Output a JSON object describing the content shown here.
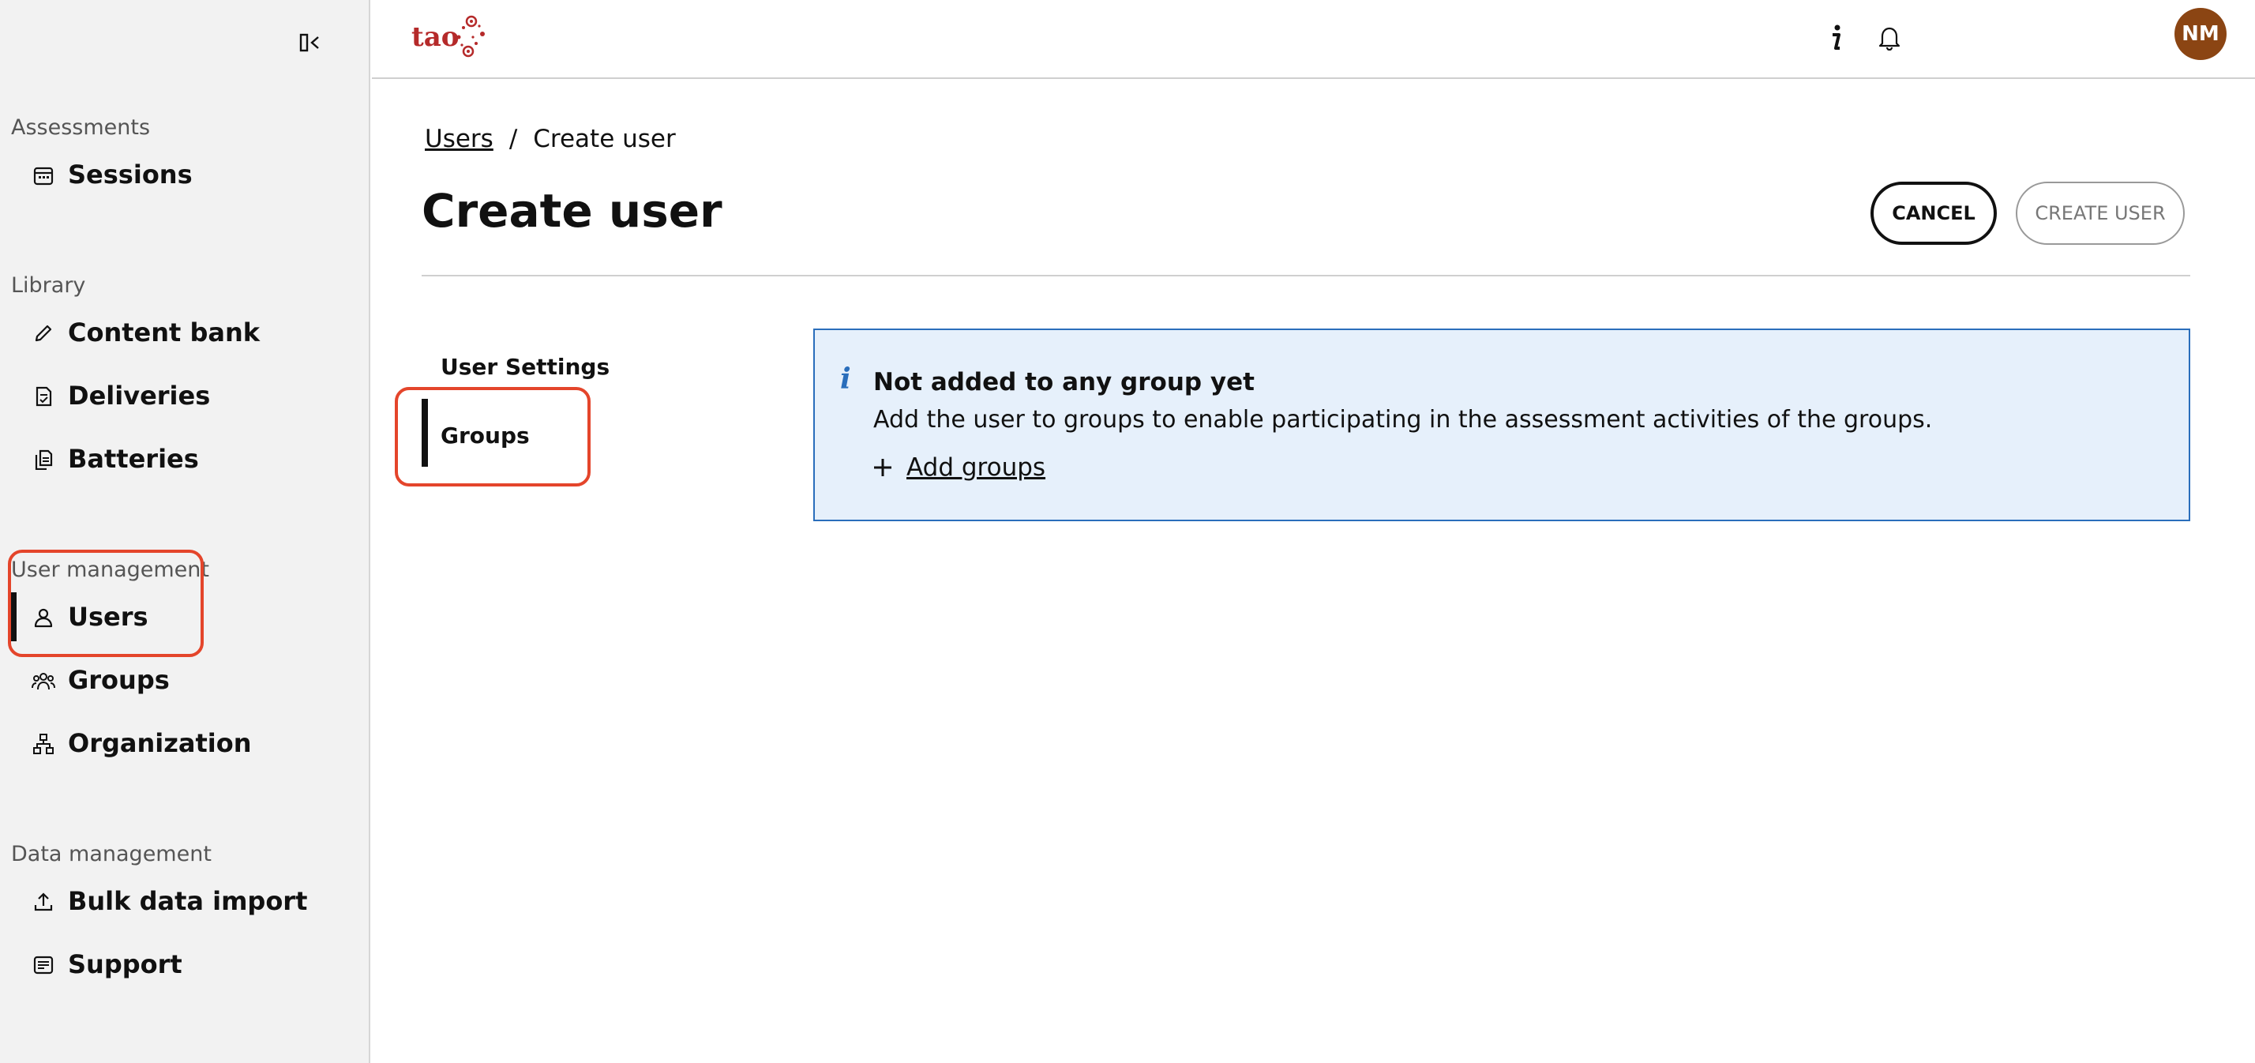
{
  "sidebar": {
    "sections": {
      "assessments": "Assessments",
      "library": "Library",
      "user_management": "User management",
      "data_management": "Data management"
    },
    "items": {
      "sessions": "Sessions",
      "content_bank": "Content bank",
      "deliveries": "Deliveries",
      "batteries": "Batteries",
      "users": "Users",
      "groups": "Groups",
      "organization": "Organization",
      "bulk_data_import": "Bulk data import",
      "support": "Support"
    },
    "active_item": "Users"
  },
  "topbar": {
    "logo_text": "tao",
    "avatar_initials": "NM",
    "avatar_color": "#8b4513",
    "icons": [
      "info-icon",
      "bell-icon"
    ]
  },
  "breadcrumb": {
    "parent": "Users",
    "separator": "/",
    "current": "Create user"
  },
  "page": {
    "title": "Create user",
    "cancel_label": "CANCEL",
    "create_label": "CREATE USER"
  },
  "tabs": {
    "user_settings": "User Settings",
    "groups": "Groups",
    "active": "Groups"
  },
  "info_panel": {
    "title": "Not added to any group yet",
    "text": "Add the user to groups to enable participating in the assessment activities of the groups.",
    "action_label": "Add groups",
    "accent": "#2a6ebb",
    "background": "#e6f0fb"
  },
  "colors": {
    "highlight": "#e4452b",
    "brand": "#b52a2a"
  }
}
